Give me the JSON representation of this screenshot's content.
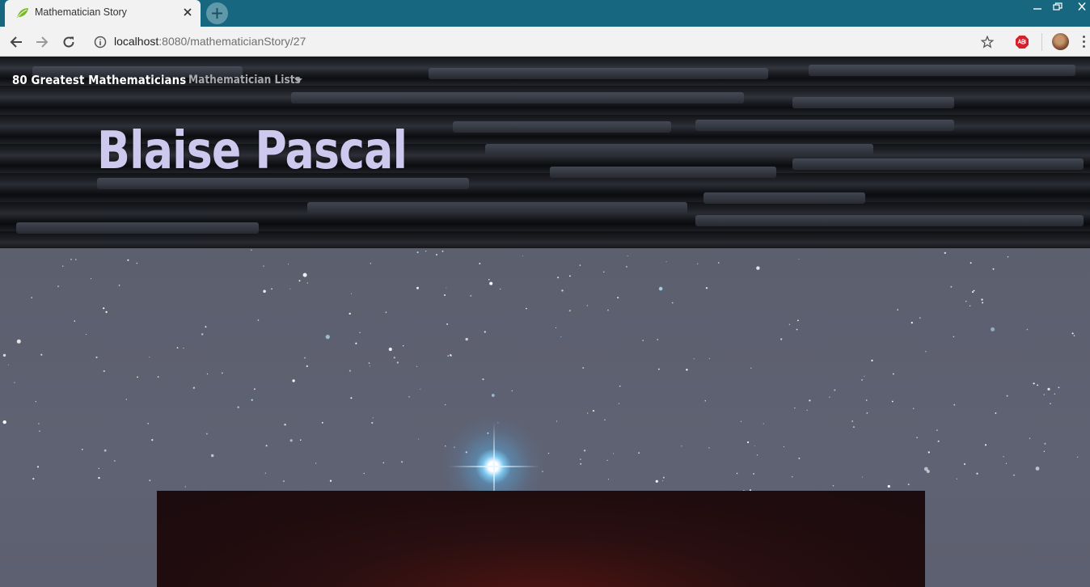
{
  "browser": {
    "tab_title": "Mathematician Story",
    "url_host": "localhost",
    "url_rest": ":8080/mathematicianStory/27"
  },
  "nav": {
    "brand": "80 Greatest Mathematicians",
    "dropdown_label": "Mathematician Lists"
  },
  "hero": {
    "title": "Blaise Pascal"
  },
  "colors": {
    "tab_strip": "#16677f",
    "title_text": "#ccc8ee",
    "brand_text": "#ffffff",
    "dropdown_text": "#a9a9ad"
  },
  "icons": [
    "leaf-favicon-icon",
    "close-icon",
    "plus-icon",
    "minimize-icon",
    "restore-icon",
    "window-close-icon",
    "back-arrow-icon",
    "forward-arrow-icon",
    "reload-icon",
    "info-icon",
    "star-icon",
    "adblock-icon",
    "avatar",
    "more-menu-icon",
    "caret-down-icon"
  ]
}
